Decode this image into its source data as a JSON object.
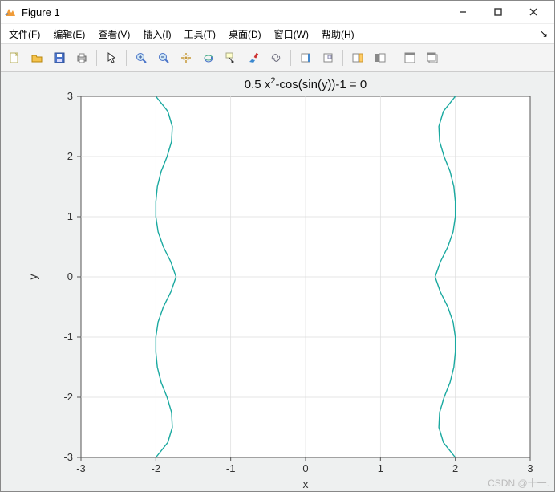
{
  "window": {
    "title": "Figure 1"
  },
  "menu": {
    "file": "文件(F)",
    "edit": "编辑(E)",
    "view": "查看(V)",
    "insert": "插入(I)",
    "tools": "工具(T)",
    "desktop": "桌面(D)",
    "window": "窗口(W)",
    "help": "帮助(H)"
  },
  "toolbar": {
    "new": "New Figure",
    "open": "Open",
    "save": "Save",
    "print": "Print",
    "pointer": "Edit Plot",
    "zoom_in": "Zoom In",
    "zoom_out": "Zoom Out",
    "pan": "Pan",
    "rotate": "Rotate 3D",
    "datacursor": "Data Cursor",
    "brush": "Brush",
    "link": "Link Plot",
    "colorbar": "Insert Colorbar",
    "legend": "Insert Legend",
    "hide_tools": "Hide Plot Tools",
    "show_tools": "Show Plot Tools",
    "dock": "Dock",
    "undock": "Undock"
  },
  "watermark": "CSDN @十一.",
  "chart_data": {
    "type": "line",
    "title_segments": [
      "0.5 x",
      "2",
      "-cos(sin(y))-1 = 0"
    ],
    "xlabel": "x",
    "ylabel": "y",
    "xlim": [
      -3,
      3
    ],
    "ylim": [
      -3,
      3
    ],
    "xticks": [
      -3,
      -2,
      -1,
      0,
      1,
      2,
      3
    ],
    "yticks": [
      -3,
      -2,
      -1,
      0,
      1,
      2,
      3
    ],
    "grid": true,
    "line_color": "#1aa9a0",
    "equation": "0.5*x^2 - cos(sin(y)) - 1 = 0",
    "series": [
      {
        "name": "right-branch",
        "y": [
          -3.0,
          -2.75,
          -2.5,
          -2.25,
          -2.0,
          -1.75,
          -1.5,
          -1.25,
          -1.0,
          -0.75,
          -0.5,
          -0.25,
          0.0,
          0.25,
          0.5,
          0.75,
          1.0,
          1.25,
          1.5,
          1.75,
          2.0,
          2.25,
          2.5,
          2.75,
          3.0
        ],
        "x": [
          2.0,
          1.84,
          1.78,
          1.79,
          1.85,
          1.93,
          1.98,
          2.0,
          2.0,
          1.97,
          1.9,
          1.8,
          1.73,
          1.8,
          1.9,
          1.97,
          2.0,
          2.0,
          1.98,
          1.93,
          1.85,
          1.79,
          1.78,
          1.84,
          2.0
        ]
      },
      {
        "name": "left-branch",
        "y": [
          -3.0,
          -2.75,
          -2.5,
          -2.25,
          -2.0,
          -1.75,
          -1.5,
          -1.25,
          -1.0,
          -0.75,
          -0.5,
          -0.25,
          0.0,
          0.25,
          0.5,
          0.75,
          1.0,
          1.25,
          1.5,
          1.75,
          2.0,
          2.25,
          2.5,
          2.75,
          3.0
        ],
        "x": [
          -2.0,
          -1.84,
          -1.78,
          -1.79,
          -1.85,
          -1.93,
          -1.98,
          -2.0,
          -2.0,
          -1.97,
          -1.9,
          -1.8,
          -1.73,
          -1.8,
          -1.9,
          -1.97,
          -2.0,
          -2.0,
          -1.98,
          -1.93,
          -1.85,
          -1.79,
          -1.78,
          -1.84,
          -2.0
        ]
      }
    ]
  }
}
